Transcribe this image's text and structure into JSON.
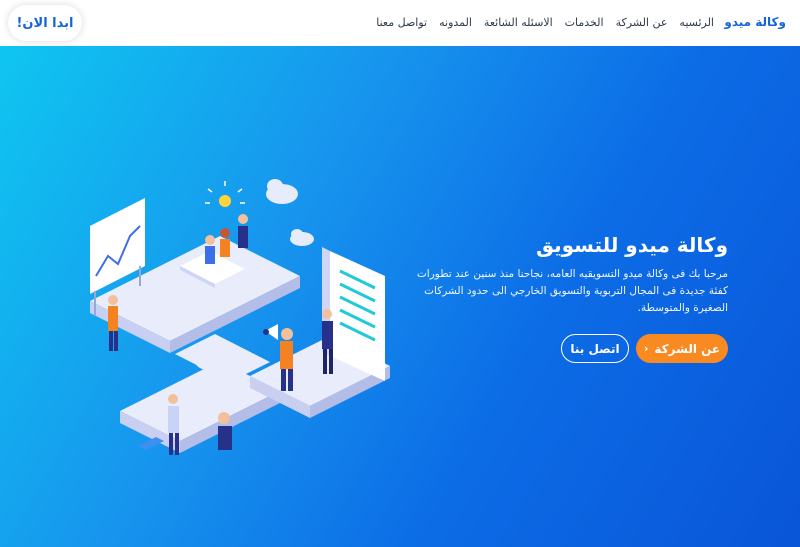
{
  "navbar": {
    "brand": "وكالة ميدو",
    "links": [
      "الرئسيه",
      "عن الشركة",
      "الخدمات",
      "الاسئله الشائعة",
      "المدونه",
      "تواصل معنا"
    ],
    "cta": "ابدا الان!"
  },
  "hero": {
    "title": "وكالة ميدو للتسويق",
    "description": "مرحبا بك فى وكالة ميدو التسويقيه العامه، نجاحنا منذ سنين عند تطورات كفئة جديدة فى المجال التربوية والتسويق الخارجي الى حدود الشركات الصغيرة والمتوسطة.",
    "about_button": "عن الشركة",
    "about_icon": "chevron-left-icon",
    "contact_button": "اتصل بنا"
  },
  "colors": {
    "brand_blue": "#1565d8",
    "cta_orange": "#f98a22",
    "gradient_start": "#0fc6f0",
    "gradient_end": "#0a55d8"
  }
}
